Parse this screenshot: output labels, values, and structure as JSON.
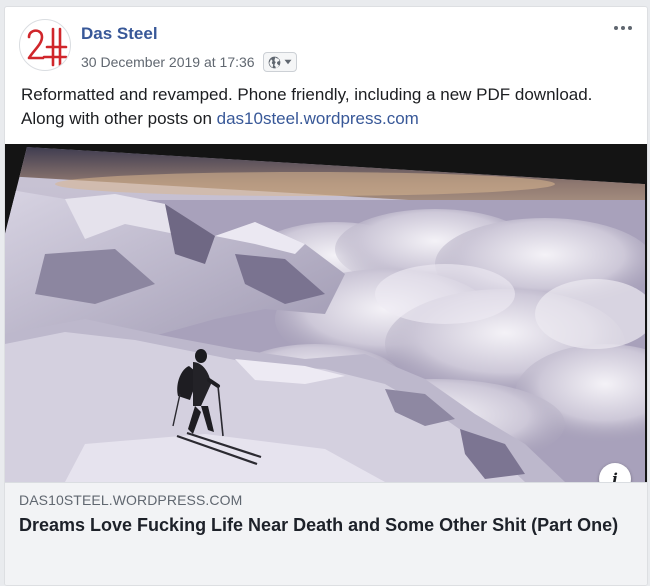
{
  "post": {
    "author": "Das Steel",
    "timestamp": "30 December 2019 at 17:36",
    "audience_icon": "globe-icon",
    "more_icon": "more-options-icon",
    "text": "Reformatted and revamped. Phone friendly, including a new PDF download. Along with other posts on",
    "link_text": "das10steel.wordpress.com"
  },
  "link_preview": {
    "domain": "DAS10STEEL.WORDPRESS.COM",
    "title": "Dreams Love Fucking Life Near Death and Some Other Shit (Part One)",
    "info_label": "i"
  },
  "colors": {
    "author": "#385898",
    "logo_red": "#d0262b",
    "card_bg": "#ffffff",
    "page_bg": "#e9ebee",
    "link_box_bg": "#f2f3f5"
  }
}
